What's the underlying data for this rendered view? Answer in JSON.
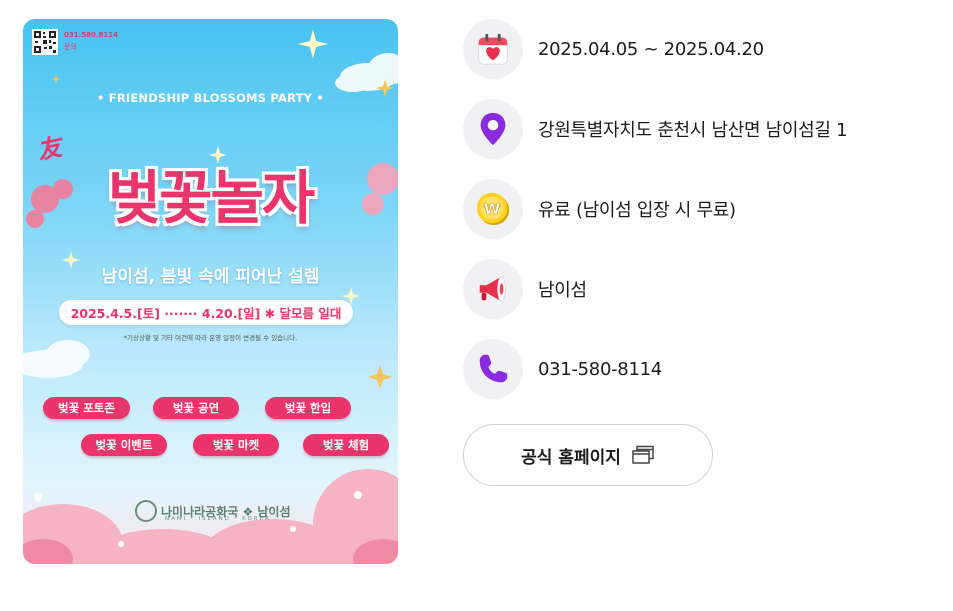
{
  "poster": {
    "qr_phone": "031.580.8114",
    "qr_ask": "문의",
    "party_title": "• FRIENDSHIP BLOSSOMS PARTY •",
    "friend_mark": "友",
    "main_title": "벚꽃놀자",
    "subtitle": "남이섬, 봄빛 속에 피어난 설렘",
    "date_range": "2025.4.5.[토] ······· 4.20.[일] ✱ 달모름 일대",
    "notice": "*기상상황 및 기타 여건에 따라 운영 일정이 변경될 수 있습니다.",
    "tags": [
      "벚꽃 포토존",
      "벚꽃 공연",
      "벚꽃 한입",
      "벚꽃 이벤트",
      "벚꽃 마켓",
      "벚꽃 체험"
    ],
    "logo_text": "나미나라공화국 ❖ 남이섬",
    "logo_sub": "NAMI · ISLAND · KOREA"
  },
  "info": {
    "period": {
      "icon": "calendar-heart-icon",
      "text": "2025.04.05 ~ 2025.04.20"
    },
    "location": {
      "icon": "location-pin-icon",
      "text": "강원특별자치도 춘천시 남산면 남이섬길 1"
    },
    "fee": {
      "icon": "coin-icon",
      "text": "유료 (남이섬 입장 시 무료)"
    },
    "host": {
      "icon": "megaphone-icon",
      "text": "남이섬"
    },
    "phone": {
      "icon": "phone-icon",
      "text": "031-580-8114"
    }
  },
  "homepage_button": {
    "label": "공식 홈페이지",
    "icon": "new-window-icon"
  },
  "colors": {
    "accent_pink": "#e9346c",
    "poster_sky": "#47c3f1",
    "icon_bg": "#f1f1f4",
    "button_border": "#cfcfd4"
  }
}
